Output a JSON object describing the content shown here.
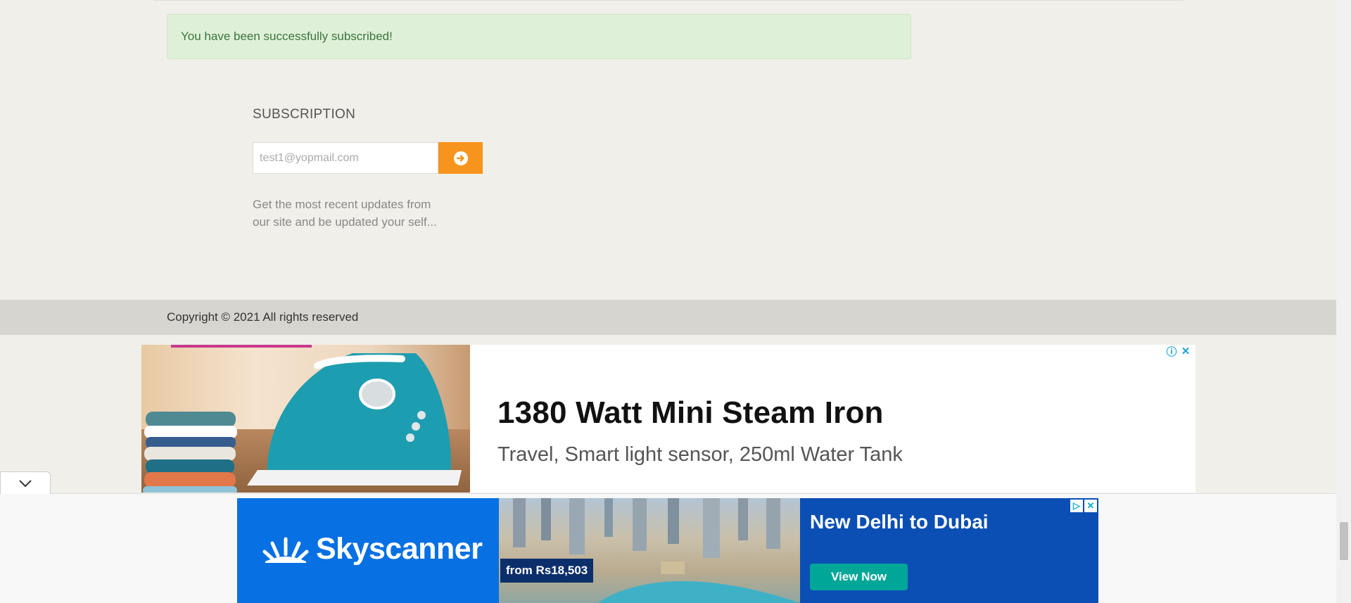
{
  "alert": {
    "message": "You have been successfully subscribed!"
  },
  "subscription": {
    "title": "SUBSCRIPTION",
    "email_placeholder": "test1@yopmail.com",
    "submit_icon": "arrow-circle-right-icon",
    "description": "Get the most recent updates from our site and be updated your self..."
  },
  "footer": {
    "copyright": "Copyright © 2021 All rights reserved"
  },
  "ad_top": {
    "headline": "1380 Watt Mini Steam Iron",
    "subline": "Travel, Smart light sensor, 250ml Water Tank",
    "icons": [
      "info-icon",
      "close-icon"
    ]
  },
  "ad_bottom": {
    "brand": "Skyscanner",
    "price": "from Rs18,503",
    "headline": "New Delhi to Dubai",
    "cta": "View Now",
    "icons": [
      "adchoices-icon",
      "close-icon"
    ]
  },
  "colors": {
    "page_bg": "#f0efe9",
    "alert_bg": "#dff0d8",
    "alert_text": "#3c763d",
    "accent": "#f7941d",
    "footer_bg": "#d6d5cf",
    "skyscanner_blue": "#0770e3",
    "cta_teal": "#00a698"
  }
}
